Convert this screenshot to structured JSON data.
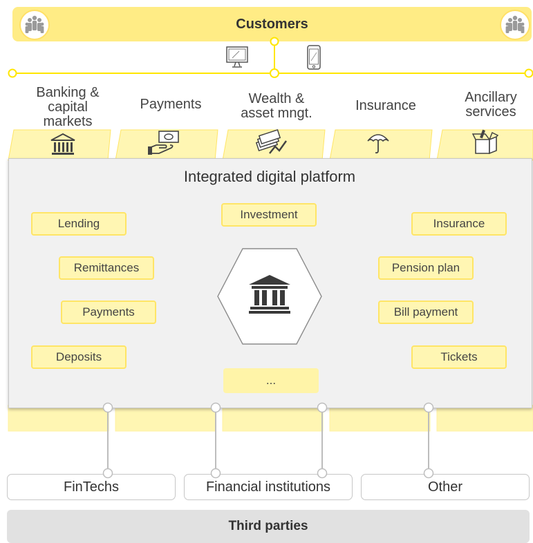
{
  "customers": {
    "label": "Customers",
    "icon_left": "people-group-icon",
    "icon_right": "people-group-icon"
  },
  "channels": [
    {
      "name": "desktop",
      "icon": "desktop-monitor-icon"
    },
    {
      "name": "mobile",
      "icon": "smartphone-icon"
    }
  ],
  "categories": [
    {
      "label": "Banking &\ncapital\nmarkets",
      "icon": "bank-building-icon"
    },
    {
      "label": "Payments",
      "icon": "hand-money-icon"
    },
    {
      "label": "Wealth &\nasset mngt.",
      "icon": "money-stack-chart-icon"
    },
    {
      "label": "Insurance",
      "icon": "umbrella-icon"
    },
    {
      "label": "Ancillary\nservices",
      "icon": "open-box-icon"
    }
  ],
  "platform": {
    "title": "Integrated digital platform",
    "center_icon": "bank-building-icon",
    "services": {
      "lending": "Lending",
      "investment": "Investment",
      "insurance": "Insurance",
      "remittances": "Remittances",
      "pension_plan": "Pension plan",
      "payments": "Payments",
      "bill_payment": "Bill payment",
      "deposits": "Deposits",
      "tickets": "Tickets",
      "more": "..."
    }
  },
  "third_parties": {
    "label": "Third parties",
    "groups": [
      "FinTechs",
      "Financial institutions",
      "Other"
    ]
  },
  "colors": {
    "yellow": "#ffe600",
    "light_yellow": "#fff6b3",
    "gray": "#e1e1e1",
    "dark": "#333333"
  }
}
